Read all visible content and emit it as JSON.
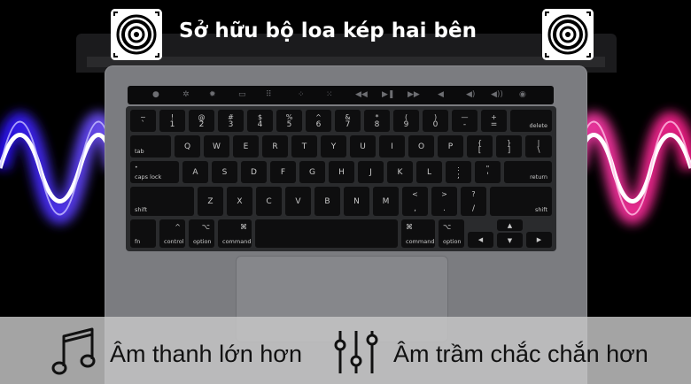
{
  "banner": {
    "title": "Sở hữu bộ loa kép hai bên",
    "icon_left": "speaker-icon",
    "icon_right": "speaker-icon"
  },
  "features": [
    {
      "icon": "music-note-icon",
      "label": "Âm thanh lớn hơn"
    },
    {
      "icon": "equalizer-icon",
      "label": "Âm trầm chắc chắn hơn"
    }
  ],
  "keyboard": {
    "row1": [
      [
        "~",
        "`"
      ],
      [
        "!",
        "1"
      ],
      [
        "@",
        "2"
      ],
      [
        "#",
        "3"
      ],
      [
        "$",
        "4"
      ],
      [
        "%",
        "5"
      ],
      [
        "^",
        "6"
      ],
      [
        "&",
        "7"
      ],
      [
        "*",
        "8"
      ],
      [
        "(",
        "9"
      ],
      [
        ")",
        "0"
      ],
      [
        "—",
        "-"
      ],
      [
        "+",
        "="
      ]
    ],
    "delete": "delete",
    "tab": "tab",
    "row2": [
      "Q",
      "W",
      "E",
      "R",
      "T",
      "Y",
      "U",
      "I",
      "O",
      "P"
    ],
    "row2_sym": [
      [
        "{",
        "["
      ],
      [
        "}",
        "]"
      ],
      [
        "|",
        "\\"
      ]
    ],
    "caps": "caps lock",
    "row3": [
      "A",
      "S",
      "D",
      "F",
      "G",
      "H",
      "J",
      "K",
      "L"
    ],
    "row3_sym": [
      [
        ":",
        ";"
      ],
      [
        "\"",
        "'"
      ]
    ],
    "return": "return",
    "shift": "shift",
    "row4": [
      "Z",
      "X",
      "C",
      "V",
      "B",
      "N",
      "M"
    ],
    "row4_sym": [
      [
        "<",
        ","
      ],
      [
        ">",
        "."
      ],
      [
        "?",
        "/"
      ]
    ],
    "fn": "fn",
    "control": "control",
    "option": "option",
    "command": "command",
    "ctrl_sym": "^",
    "opt_sym": "⌥",
    "cmd_sym": "⌘"
  },
  "colors": {
    "wave_left": "#3b2bff",
    "wave_right": "#ff2ba6"
  }
}
